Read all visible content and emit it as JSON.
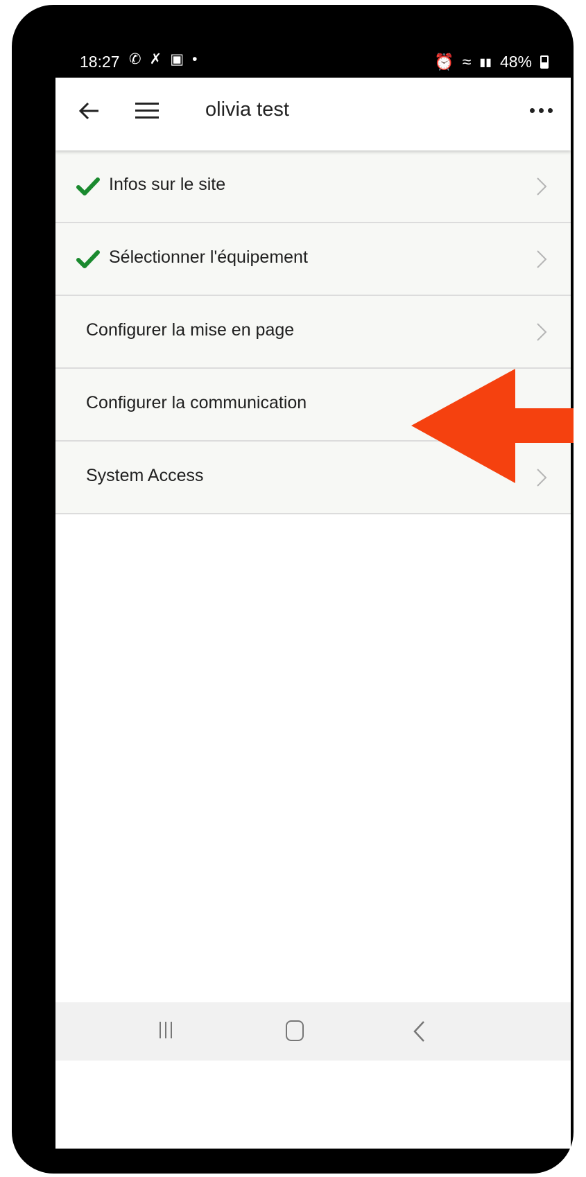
{
  "status_bar": {
    "time": "18:27",
    "left_icons": [
      "whatsapp-icon",
      "missed-call-icon",
      "gallery-icon",
      "dot-icon"
    ],
    "battery": "48%"
  },
  "app_bar": {
    "title": "olivia test"
  },
  "menu": {
    "items": [
      {
        "label": "Infos sur le site",
        "checked": true,
        "chevron": true
      },
      {
        "label": "Sélectionner l'équipement",
        "checked": true,
        "chevron": true
      },
      {
        "label": "Configurer la mise en page",
        "checked": false,
        "chevron": true
      },
      {
        "label": "Configurer la communication",
        "checked": false,
        "chevron": false
      },
      {
        "label": "System Access",
        "checked": false,
        "chevron": true
      }
    ]
  },
  "colors": {
    "check": "#1a8a2e",
    "annotation_arrow": "#f5410f",
    "row_background": "#f7f8f5"
  }
}
